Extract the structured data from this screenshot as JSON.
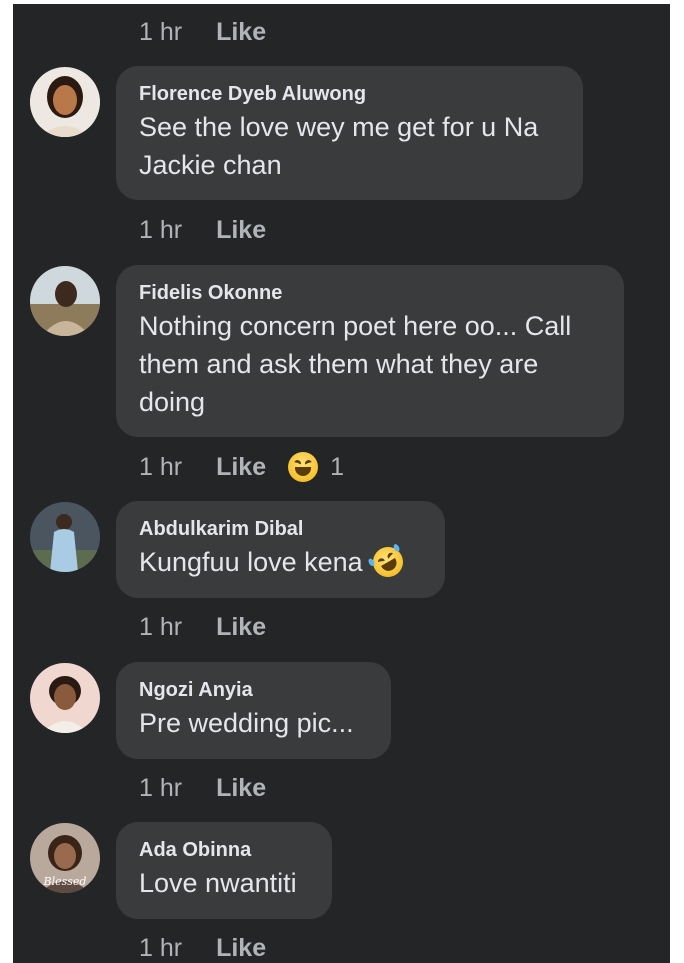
{
  "comments": [
    {
      "name": "",
      "text": "",
      "time": "1 hr",
      "like": "Like"
    },
    {
      "name": "Florence Dyeb Aluwong",
      "text": "See the love wey me get for u Na Jackie chan",
      "time": "1 hr",
      "like": "Like"
    },
    {
      "name": "Fidelis Okonne",
      "text": "Nothing concern poet here oo... Call them and ask them what they are doing",
      "time": "1 hr",
      "like": "Like",
      "reaction": "laughing-emoji",
      "reaction_count": "1"
    },
    {
      "name": "Abdulkarim Dibal",
      "text": "Kungfuu love kena",
      "text_emoji": "rofl-emoji",
      "time": "1 hr",
      "like": "Like"
    },
    {
      "name": "Ngozi Anyia",
      "text": "Pre wedding pic...",
      "time": "1 hr",
      "like": "Like"
    },
    {
      "name": "Ada Obinna",
      "text": "Love nwantiti",
      "time": "1 hr",
      "like": "Like",
      "avatar_overlay": "Blessed"
    }
  ],
  "colors": {
    "background": "#242526",
    "bubble": "#3a3b3c",
    "text": "#e4e6eb",
    "meta": "#b0b3b8"
  }
}
